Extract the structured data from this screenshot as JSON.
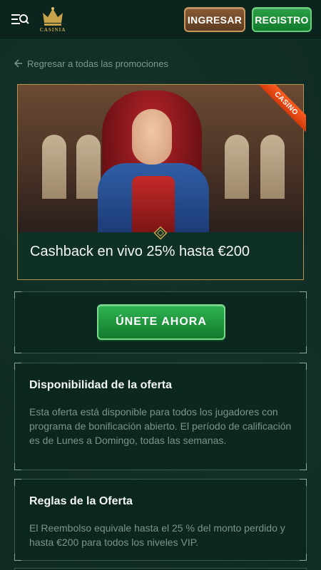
{
  "header": {
    "logo_text": "CASINIA",
    "login_label": "INGRESAR",
    "register_label": "REGISTRO"
  },
  "back_link": {
    "label": "Regresar a todas las promociones"
  },
  "promo": {
    "badge": "CASINO",
    "title": "Cashback en vivo 25% hasta €200"
  },
  "cta": {
    "join_label": "ÚNETE AHORA"
  },
  "sections": [
    {
      "title": "Disponibilidad de la oferta",
      "body": "Esta oferta está disponible para todos los jugadores con programa de bonificación abierto. El período de calificación es de Lunes a Domingo, todas las semanas."
    },
    {
      "title": "Reglas de la Oferta",
      "body": "El Reembolso equivale hasta el 25 % del monto perdido y hasta €200 para todos los niveles VIP."
    }
  ],
  "colors": {
    "background": "#0e2a22",
    "login_button": "#7a4e2c",
    "register_button": "#1f8f3b",
    "join_button": "#1f9a40",
    "casino_badge": "#ff5b1f",
    "card_border": "#b8934f"
  }
}
